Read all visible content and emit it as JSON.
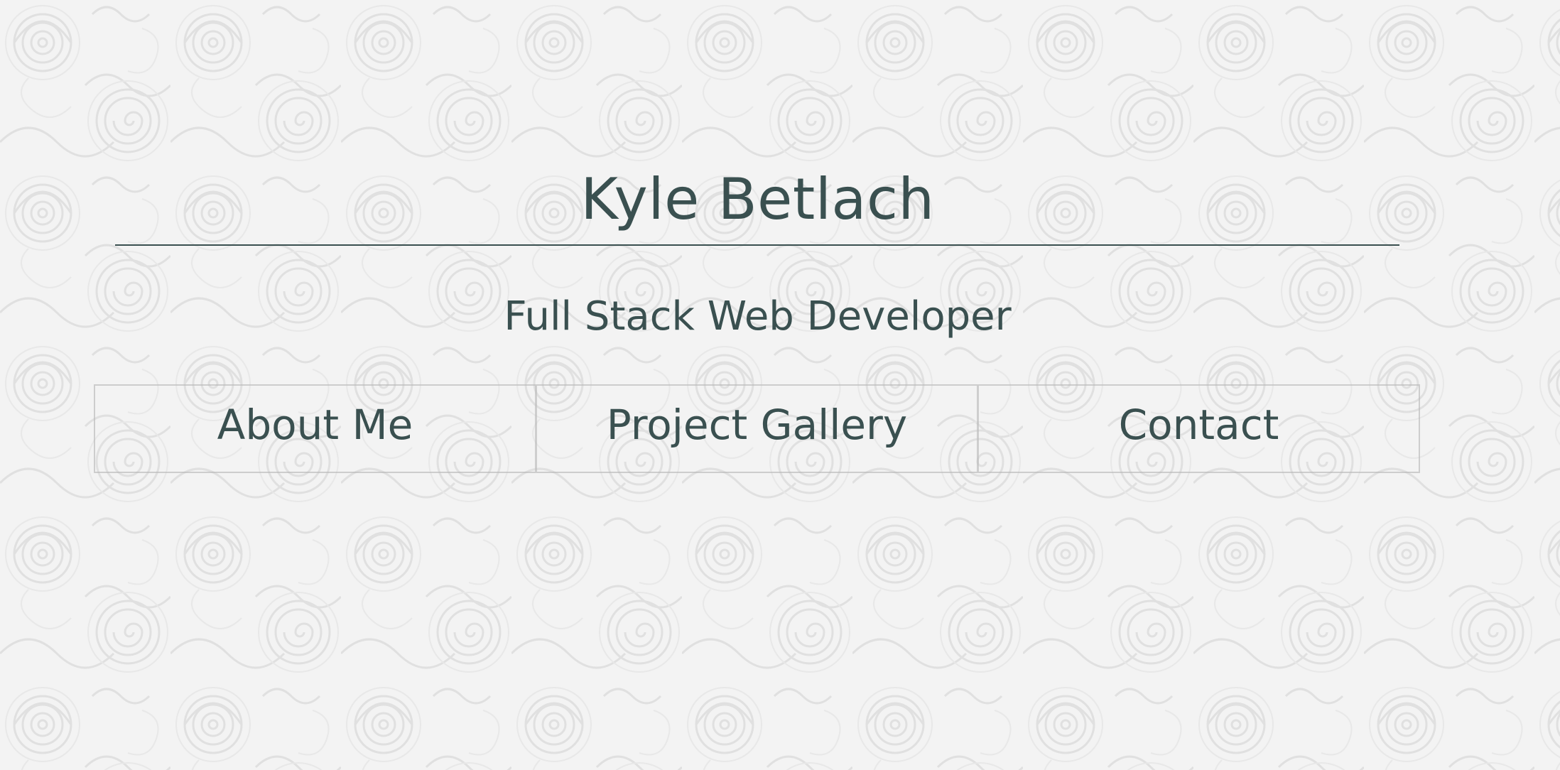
{
  "header": {
    "name": "Kyle Betlach",
    "role": "Full Stack Web Developer"
  },
  "nav": {
    "items": [
      {
        "label": "About Me"
      },
      {
        "label": "Project Gallery"
      },
      {
        "label": "Contact"
      }
    ]
  },
  "colors": {
    "text": "#3a5050",
    "background": "#f2f2f2",
    "pattern": "#e3e3e3"
  }
}
